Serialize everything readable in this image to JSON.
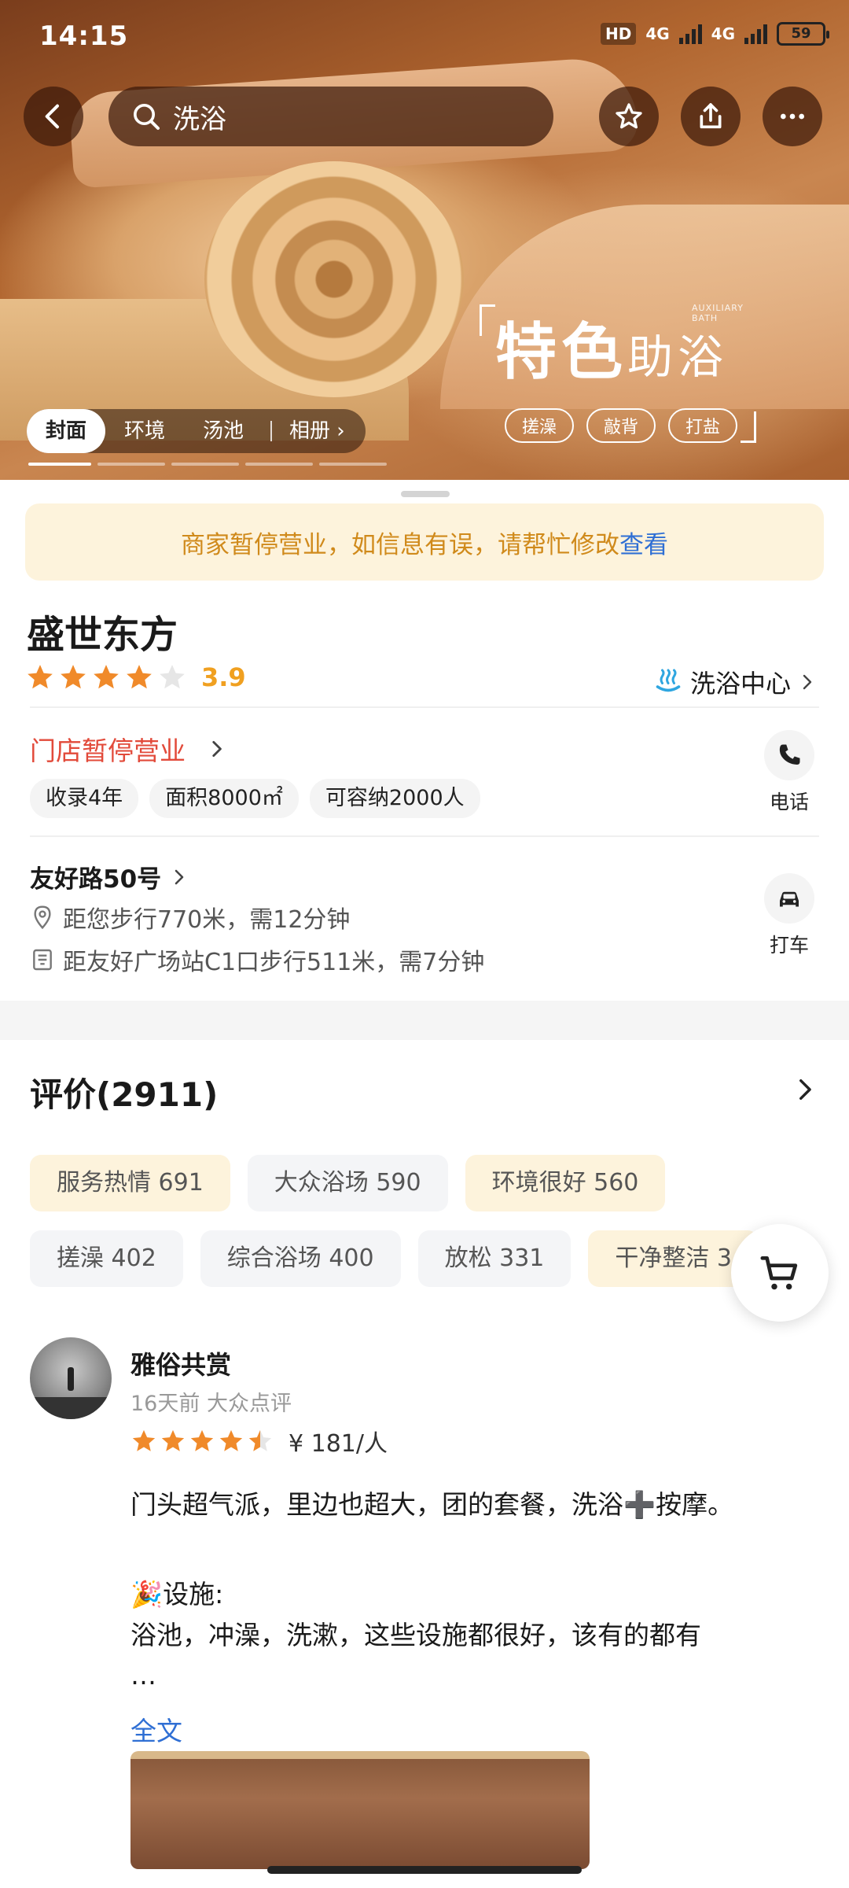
{
  "status_bar": {
    "time": "14:15",
    "hd": "HD",
    "net1": "4G",
    "net2": "4G",
    "battery": "59"
  },
  "header": {
    "search_query": "洗浴"
  },
  "hero": {
    "promo_title_a": "特色",
    "promo_title_b": "助浴",
    "promo_subtitle": "AUXILIARY BATH",
    "promo_tags": [
      "搓澡",
      "敲背",
      "打盐"
    ],
    "gallery_tabs": [
      "封面",
      "环境",
      "汤池"
    ],
    "album_label": "相册 ›"
  },
  "notice": {
    "text": "商家暂停营业，如信息有误，请帮忙修改",
    "link": "查看"
  },
  "shop": {
    "name": "盛世东方",
    "rating": 3.9,
    "rating_text": "3.9",
    "category": "洗浴中心",
    "status": "门店暂停营业",
    "tags": [
      "收录4年",
      "面积8000㎡",
      "可容纳2000人"
    ],
    "phone_label": "电话",
    "address": "友好路50号",
    "walk_distance": "距您步行770米，需12分钟",
    "transit_distance": "距友好广场站C1口步行511米，需7分钟",
    "taxi_label": "打车"
  },
  "reviews": {
    "title": "评价(2911)",
    "chips_row1": [
      "服务热情 691",
      "大众浴场 590",
      "环境很好 560"
    ],
    "chips_row2": [
      "搓澡 402",
      "综合浴场 400",
      "放松 331",
      "干净整洁 3"
    ],
    "first": {
      "user": "雅俗共赏",
      "meta": "16天前 大众点评",
      "stars": 4.5,
      "price": "¥ 181/人",
      "line1": "门头超气派，里边也超大，团的套餐，洗浴➕按摩。",
      "line2": "🎉设施:",
      "line3": "浴池，冲澡，洗漱，这些设施都很好，该有的都有",
      "ellipsis": "…",
      "more_link": "全文"
    }
  },
  "colors": {
    "accent_orange": "#f08a2a",
    "score": "#f0a020",
    "closed_red": "#e24a3a",
    "link_blue": "#2f6fd4",
    "notice_bg": "#fdf3dc"
  }
}
